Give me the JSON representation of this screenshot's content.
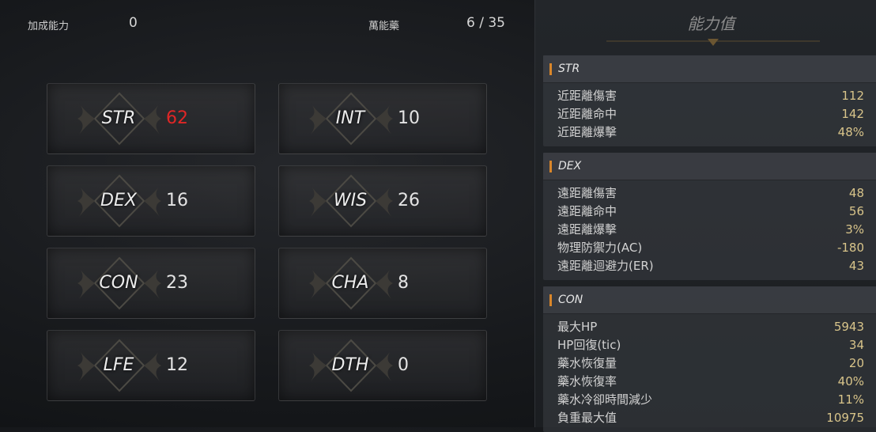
{
  "bonus": {
    "label": "加成能力",
    "value": "0"
  },
  "elixir": {
    "label": "萬能藥",
    "value": "6 / 35"
  },
  "stats": [
    {
      "name": "STR",
      "value": "62",
      "highlight": true
    },
    {
      "name": "INT",
      "value": "10"
    },
    {
      "name": "DEX",
      "value": "16"
    },
    {
      "name": "WIS",
      "value": "26"
    },
    {
      "name": "CON",
      "value": "23"
    },
    {
      "name": "CHA",
      "value": "8"
    },
    {
      "name": "LFE",
      "value": "12"
    },
    {
      "name": "DTH",
      "value": "0"
    }
  ],
  "panel": {
    "title": "能力值",
    "sections": [
      {
        "title": "STR",
        "rows": [
          {
            "label": "近距離傷害",
            "value": "112"
          },
          {
            "label": "近距離命中",
            "value": "142"
          },
          {
            "label": "近距離爆擊",
            "value": "48%"
          }
        ]
      },
      {
        "title": "DEX",
        "rows": [
          {
            "label": "遠距離傷害",
            "value": "48"
          },
          {
            "label": "遠距離命中",
            "value": "56"
          },
          {
            "label": "遠距離爆擊",
            "value": "3%"
          },
          {
            "label": "物理防禦力(AC)",
            "value": "-180"
          },
          {
            "label": "遠距離迴避力(ER)",
            "value": "43"
          }
        ]
      },
      {
        "title": "CON",
        "rows": [
          {
            "label": "最大HP",
            "value": "5943"
          },
          {
            "label": "HP回復(tic)",
            "value": "34"
          },
          {
            "label": "藥水恢復量",
            "value": "20"
          },
          {
            "label": "藥水恢復率",
            "value": "40%"
          },
          {
            "label": "藥水冷卻時間減少",
            "value": "11%"
          },
          {
            "label": "負重最大值",
            "value": "10975"
          }
        ]
      }
    ]
  },
  "colors": {
    "highlight": "#e02626",
    "accent": "#d9862a",
    "value_text": "#d8c48a"
  },
  "icons": {
    "stat_emblem": "winged-diamond-emblem-icon",
    "title_ornament": "ornament-divider-icon"
  }
}
